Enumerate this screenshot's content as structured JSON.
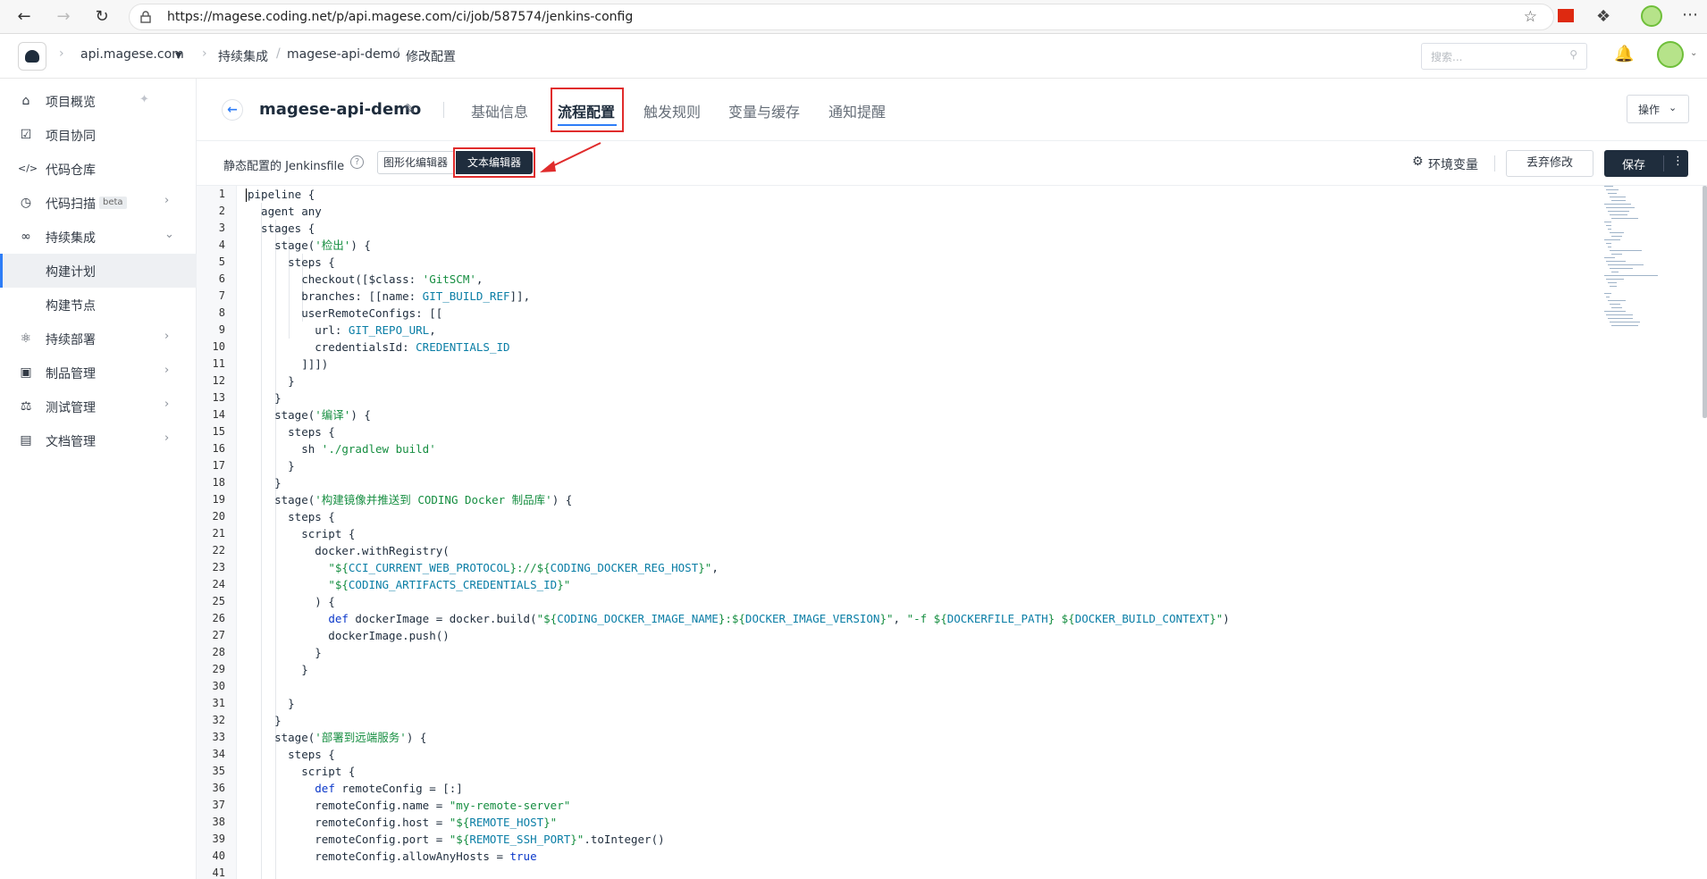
{
  "browser": {
    "url": "https://magese.coding.net/p/api.magese.com/ci/job/587574/jenkins-config"
  },
  "header": {
    "team": "api.magese.com",
    "breadcrumb": [
      "持续集成",
      "magese-api-demo",
      "修改配置"
    ],
    "search_placeholder": "搜索..."
  },
  "sidebar": {
    "items": [
      {
        "label": "项目概览",
        "icon": "home-icon"
      },
      {
        "label": "项目协同",
        "icon": "check-square-icon"
      },
      {
        "label": "代码仓库",
        "icon": "code-icon"
      },
      {
        "label": "代码扫描",
        "icon": "scan-icon",
        "badge": "beta"
      },
      {
        "label": "持续集成",
        "icon": "infinity-icon"
      },
      {
        "label": "构建计划",
        "icon": ""
      },
      {
        "label": "构建节点",
        "icon": ""
      },
      {
        "label": "持续部署",
        "icon": "rocket-icon"
      },
      {
        "label": "制品管理",
        "icon": "box-icon"
      },
      {
        "label": "测试管理",
        "icon": "flask-icon"
      },
      {
        "label": "文档管理",
        "icon": "book-icon"
      }
    ]
  },
  "project": {
    "name": "magese-api-demo",
    "tabs": [
      "基础信息",
      "流程配置",
      "触发规则",
      "变量与缓存",
      "通知提醒"
    ],
    "active_tab": "流程配置",
    "ops_label": "操作"
  },
  "toolbar": {
    "static_label": "静态配置的 Jenkinsfile",
    "graphic_editor": "图形化编辑器",
    "text_editor": "文本编辑器",
    "env_label": "环境变量",
    "discard_label": "丢弃修改",
    "save_label": "保存"
  },
  "editor": {
    "line_numbers": [
      "1",
      "2",
      "3",
      "4",
      "5",
      "6",
      "7",
      "8",
      "9",
      "10",
      "11",
      "12",
      "13",
      "14",
      "15",
      "16",
      "17",
      "18",
      "19",
      "20",
      "21",
      "22",
      "23",
      "24",
      "25",
      "26",
      "27",
      "28",
      "29",
      "30",
      "31",
      "32",
      "33",
      "34",
      "35",
      "36",
      "37",
      "38",
      "39",
      "40",
      "41"
    ]
  },
  "colors": {
    "accent": "#2e7df7",
    "dark": "#1f2d3d",
    "highlight": "#e02c2c",
    "string": "#168e41",
    "keyword": "#0a37c9"
  }
}
